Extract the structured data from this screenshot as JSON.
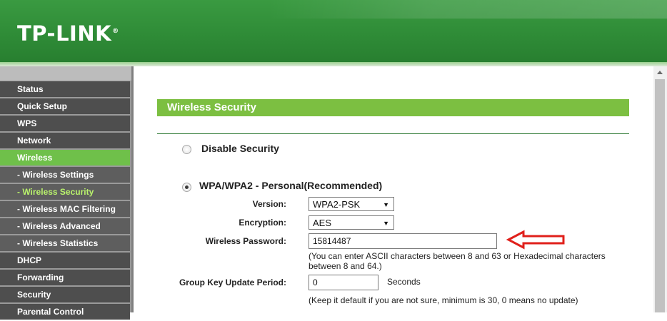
{
  "header": {
    "logo": "TP-LINK",
    "logo_mark": "®"
  },
  "sidebar": {
    "items": [
      {
        "label": "Status",
        "level": "top",
        "active": false
      },
      {
        "label": "Quick Setup",
        "level": "top",
        "active": false
      },
      {
        "label": "WPS",
        "level": "top",
        "active": false
      },
      {
        "label": "Network",
        "level": "top",
        "active": false
      },
      {
        "label": "Wireless",
        "level": "top",
        "active": true
      },
      {
        "label": "- Wireless Settings",
        "level": "sub",
        "active": false
      },
      {
        "label": "- Wireless Security",
        "level": "sub",
        "active": true
      },
      {
        "label": "- Wireless MAC Filtering",
        "level": "sub",
        "active": false
      },
      {
        "label": "- Wireless Advanced",
        "level": "sub",
        "active": false
      },
      {
        "label": "- Wireless Statistics",
        "level": "sub",
        "active": false
      },
      {
        "label": "DHCP",
        "level": "top",
        "active": false
      },
      {
        "label": "Forwarding",
        "level": "top",
        "active": false
      },
      {
        "label": "Security",
        "level": "top",
        "active": false
      },
      {
        "label": "Parental Control",
        "level": "top",
        "active": false
      }
    ]
  },
  "main": {
    "section_title": "Wireless Security",
    "disable_security": {
      "label": "Disable Security",
      "selected": false
    },
    "wpa_personal": {
      "label": "WPA/WPA2 - Personal(Recommended)",
      "selected": true,
      "version_label": "Version:",
      "version_value": "WPA2-PSK",
      "encryption_label": "Encryption:",
      "encryption_value": "AES",
      "password_label": "Wireless Password:",
      "password_value": "15814487",
      "password_hint": "(You can enter ASCII characters between 8 and 63 or Hexadecimal characters between 8 and 64.)",
      "group_key_label": "Group Key Update Period:",
      "group_key_value": "0",
      "group_key_unit": "Seconds",
      "group_key_hint": "(Keep it default if you are not sure, minimum is 30, 0 means no update)"
    }
  },
  "colors": {
    "header_green": "#2f8c37",
    "accent_green": "#7cbf41",
    "active_menu": "#6fc04a",
    "menu_bg": "#4e4e4e",
    "arrow_red": "#e0201b"
  },
  "icons": {
    "annotation": "red-outline-arrow-icon",
    "dropdown": "chevron-down-icon"
  }
}
